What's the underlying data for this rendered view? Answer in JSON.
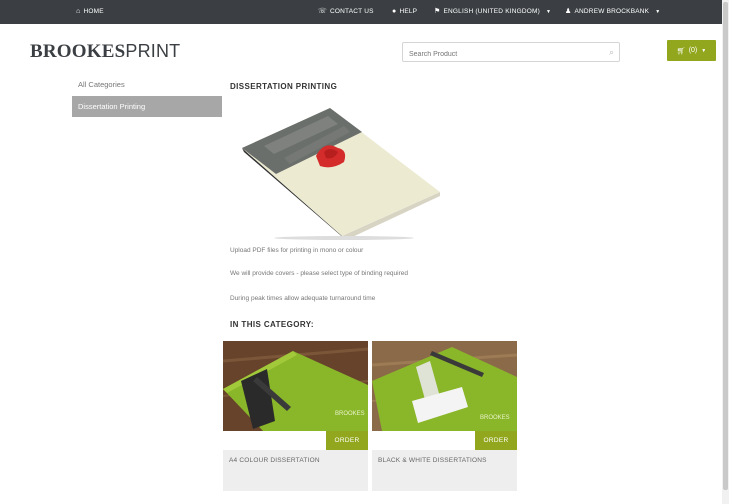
{
  "topbar": {
    "home": "HOME",
    "contact": "CONTACT US",
    "help": "HELP",
    "language": "ENGLISH (UNITED KINGDOM)",
    "user": "ANDREW BROCKBANK",
    "icons": [
      "home-icon",
      "phone-icon",
      "help-icon",
      "flag-icon",
      "user-icon"
    ]
  },
  "header": {
    "logo_bold": "BROOKES",
    "logo_light": "PRINT",
    "search_placeholder": "Search Product",
    "cart_label": "(0)",
    "accent": "#92a71d"
  },
  "sidebar": {
    "items": [
      {
        "label": "All Categories"
      },
      {
        "label": "Dissertation Printing"
      }
    ]
  },
  "main": {
    "title": "DISSERTATION PRINTING",
    "paragraphs": [
      "Upload PDF files for printing in mono or colour",
      "We will provide covers - please select type of binding required",
      "During peak times allow adequate turnaround time"
    ],
    "category_title": "IN THIS CATEGORY:",
    "products": [
      {
        "name": "A4 COLOUR DISSERTATION",
        "order_label": "ORDER"
      },
      {
        "name": "BLACK & WHITE DISSERTATIONS",
        "order_label": "ORDER"
      }
    ]
  }
}
